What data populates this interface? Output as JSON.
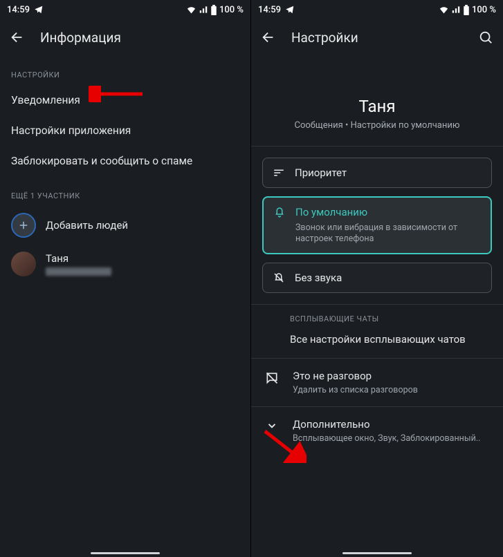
{
  "status": {
    "time": "14:59",
    "battery": "100 %"
  },
  "left": {
    "title": "Информация",
    "section_settings": "НАСТРОЙКИ",
    "notifications": "Уведомления",
    "app_settings": "Настройки приложения",
    "block_spam": "Заблокировать и сообщить о спаме",
    "participants_header": "ЕЩЁ 1 УЧАСТНИК",
    "add_people": "Добавить людей",
    "participant_name": "Таня"
  },
  "right": {
    "title": "Настройки",
    "contact": "Таня",
    "contact_sub": "Сообщения • Настройки по умолчанию",
    "opt_priority": "Приоритет",
    "opt_default": "По умолчанию",
    "opt_default_desc": "Звонок или вибрация в зависимости от настроек телефона",
    "opt_silent": "Без звука",
    "bubble_header": "ВСПЛЫВАЮЩИЕ ЧАТЫ",
    "bubble_all": "Все настройки всплывающих чатов",
    "not_convo_t": "Это не разговор",
    "not_convo_s": "Удалить из списка разговоров",
    "more_t": "Дополнительно",
    "more_s": "Всплывающее окно, Звук, Заблокированный.."
  }
}
